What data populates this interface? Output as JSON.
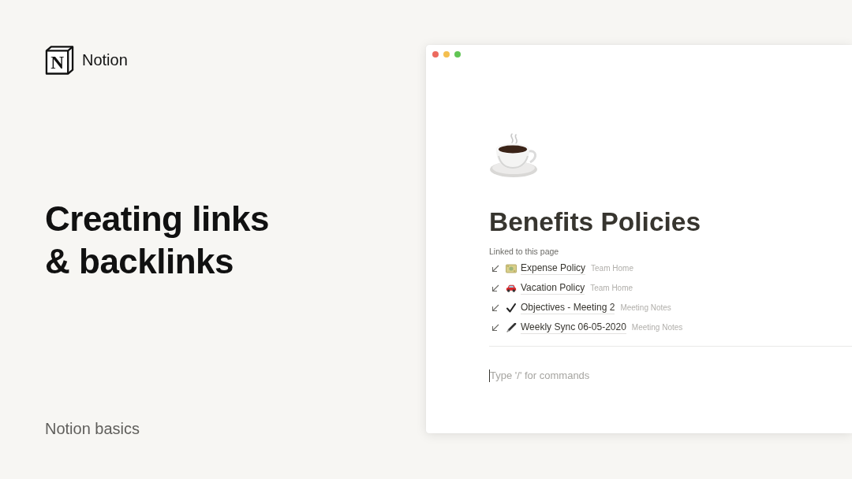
{
  "brand": {
    "logo_letter": "N",
    "name": "Notion"
  },
  "headline": "Creating links & backlinks",
  "series": "Notion basics",
  "window": {
    "page": {
      "title": "Benefits Policies",
      "backlinks": {
        "heading": "Linked to this page",
        "items": [
          {
            "title": "Expense Policy",
            "location": "Team Home"
          },
          {
            "title": "Vacation Policy",
            "location": "Team Home"
          },
          {
            "title": "Objectives - Meeting 2",
            "location": "Meeting Notes"
          },
          {
            "title": "Weekly Sync 06-05-2020",
            "location": "Meeting Notes"
          }
        ]
      },
      "block": {
        "placeholder": "Type '/' for commands"
      }
    }
  }
}
